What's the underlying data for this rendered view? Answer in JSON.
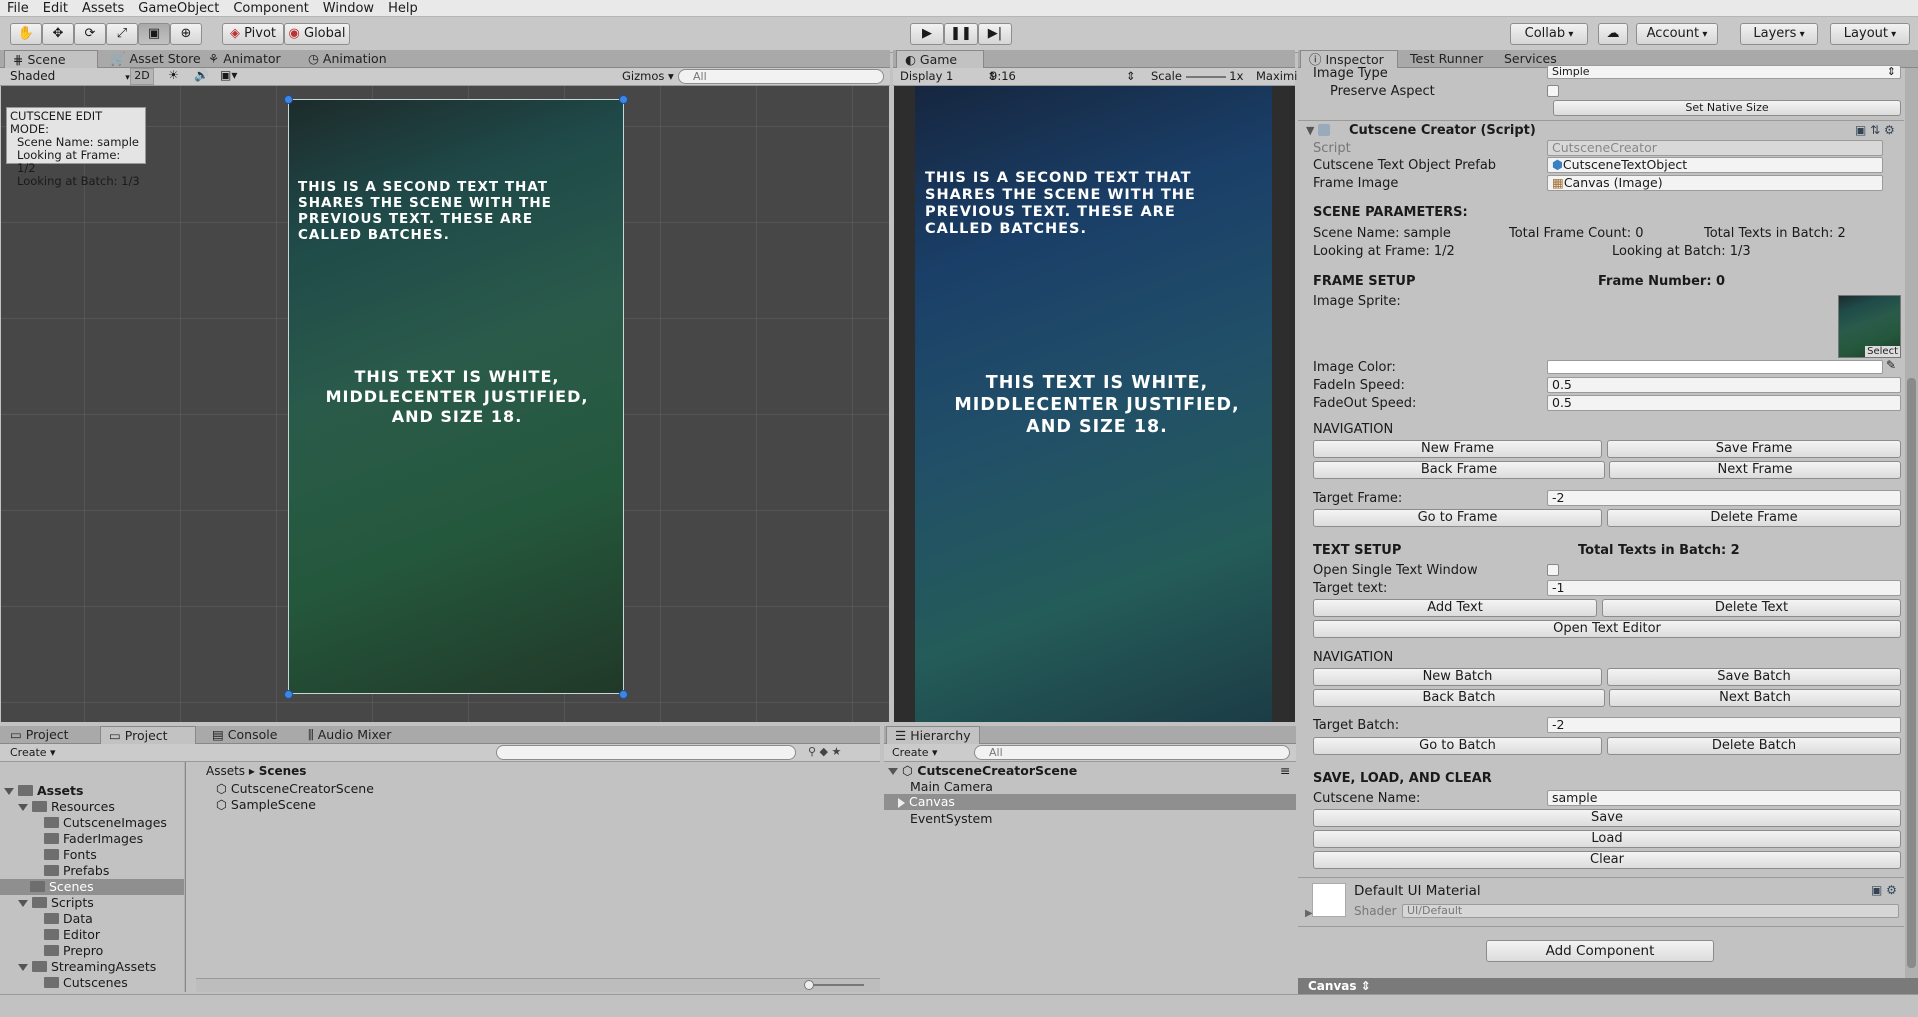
{
  "menu": [
    "File",
    "Edit",
    "Assets",
    "GameObject",
    "Component",
    "Window",
    "Help"
  ],
  "toolbar": {
    "pivot": "Pivot",
    "global": "Global",
    "collab": "Collab",
    "account": "Account",
    "layers": "Layers",
    "layout": "Layout"
  },
  "scene_tabs": {
    "scene": "Scene",
    "asset_store": "Asset Store",
    "animator": "Animator",
    "animation": "Animation"
  },
  "scene_bar": {
    "shaded": "Shaded",
    "mode2d": "2D",
    "gizmos": "Gizmos",
    "search": "All"
  },
  "overlay": {
    "title": "CUTSCENE EDIT MODE:",
    "scene_name": "Scene Name: sample",
    "frame": "Looking at Frame: 1/2",
    "batch": "Looking at Batch: 1/3"
  },
  "canvas_text": {
    "second": "This is a second text that shares the scene with the previous text. These are called batches.",
    "white": "This text is white, MiddleCenter justified, and size 18."
  },
  "game_tab": {
    "label": "Game",
    "display": "Display 1",
    "aspect": "9:16",
    "scale_label": "Scale",
    "scale_value": "1x",
    "maximize": "Maximi"
  },
  "inspector": {
    "tabs": [
      "Inspector",
      "Test Runner",
      "Services"
    ],
    "image_type_label": "Image Type",
    "image_type_value": "Simple",
    "preserve_aspect": "Preserve Aspect",
    "set_native_size": "Set Native Size",
    "component_title": "Cutscene Creator (Script)",
    "script_label": "Script",
    "script_value": "CutsceneCreator",
    "prefab_label": "Cutscene Text Object Prefab",
    "prefab_value": "CutsceneTextObject",
    "frame_image_label": "Frame Image",
    "frame_image_value": "Canvas (Image)",
    "scene_params": "SCENE PARAMETERS:",
    "scene_name": "Scene Name: sample",
    "total_frame_count": "Total Frame Count: 0",
    "total_texts": "Total Texts in Batch: 2",
    "looking_frame": "Looking at Frame: 1/2",
    "looking_batch": "Looking at Batch: 1/3",
    "frame_setup": "FRAME SETUP",
    "frame_number": "Frame Number: 0",
    "image_sprite": "Image Sprite:",
    "select": "Select",
    "image_color": "Image Color:",
    "fadein_label": "FadeIn Speed:",
    "fadein_value": "0.5",
    "fadeout_label": "FadeOut Speed:",
    "fadeout_value": "0.5",
    "navigation": "NAVIGATION",
    "new_frame": "New Frame",
    "save_frame": "Save Frame",
    "back_frame": "Back Frame",
    "next_frame": "Next Frame",
    "target_frame_label": "Target Frame:",
    "target_frame_value": "-2",
    "go_to_frame": "Go to Frame",
    "delete_frame": "Delete Frame",
    "text_setup": "TEXT SETUP",
    "total_texts_bold": "Total Texts in Batch: 2",
    "open_single": "Open Single Text Window",
    "target_text_label": "Target text:",
    "target_text_value": "-1",
    "add_text": "Add Text",
    "delete_text": "Delete Text",
    "open_text_editor": "Open Text Editor",
    "navigation2": "NAVIGATION",
    "new_batch": "New Batch",
    "save_batch": "Save Batch",
    "back_batch": "Back Batch",
    "next_batch": "Next Batch",
    "target_batch_label": "Target Batch:",
    "target_batch_value": "-2",
    "go_to_batch": "Go to Batch",
    "delete_batch": "Delete Batch",
    "save_load_clear": "SAVE, LOAD, AND CLEAR",
    "cutscene_name_label": "Cutscene Name:",
    "cutscene_name_value": "sample",
    "save": "Save",
    "load": "Load",
    "clear": "Clear",
    "material": "Default UI Material",
    "shader_label": "Shader",
    "shader_value": "UI/Default",
    "add_component": "Add Component",
    "footer": "Canvas"
  },
  "project": {
    "tabs": [
      "Project",
      "Project",
      "Console",
      "Audio Mixer"
    ],
    "create": "Create",
    "tree": [
      "Assets",
      "Resources",
      "CutsceneImages",
      "FaderImages",
      "Fonts",
      "Prefabs",
      "Scenes",
      "Scripts",
      "Data",
      "Editor",
      "Prepro",
      "StreamingAssets",
      "Cutscenes"
    ],
    "breadcrumb_root": "Assets",
    "breadcrumb_leaf": "Scenes",
    "files": [
      "CutsceneCreatorScene",
      "SampleScene"
    ]
  },
  "hierarchy": {
    "tab": "Hierarchy",
    "create": "Create",
    "search": "All",
    "scene": "CutsceneCreatorScene",
    "items": [
      "Main Camera",
      "Canvas",
      "EventSystem"
    ]
  }
}
